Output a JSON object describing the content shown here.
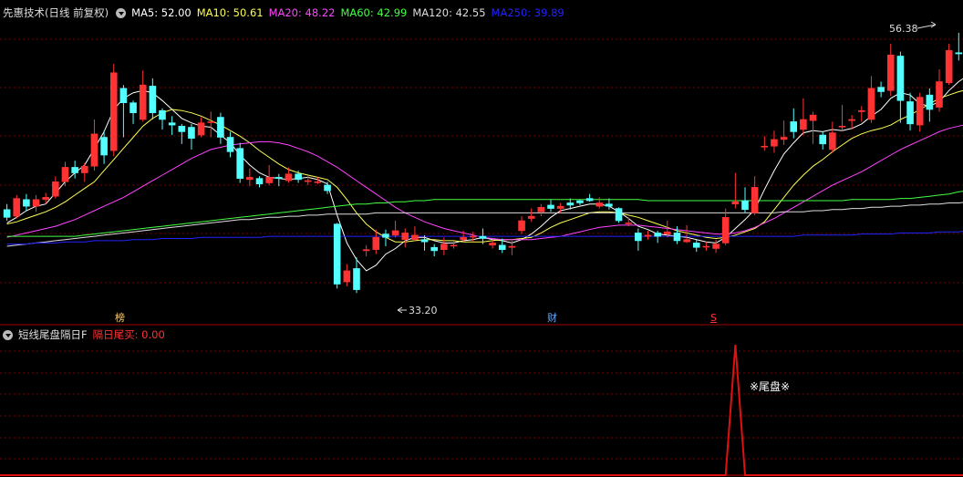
{
  "main_panel": {
    "title": "先惠技术(日线 前复权)",
    "ma_labels": [
      {
        "text": "MA5: 52.00",
        "color": "#ffffff"
      },
      {
        "text": "MA10: 50.61",
        "color": "#ffff55"
      },
      {
        "text": "MA20: 48.22",
        "color": "#ff44ff"
      },
      {
        "text": "MA60: 42.99",
        "color": "#44ff44"
      },
      {
        "text": "MA120: 42.55",
        "color": "#dddddd"
      },
      {
        "text": "MA250: 39.89",
        "color": "#2222ff"
      }
    ],
    "high_label": "56.38",
    "low_label": "33.20",
    "markers": [
      {
        "text": "榜",
        "color": "#ffcc66"
      },
      {
        "text": "财",
        "color": "#66aaff"
      },
      {
        "text": "S",
        "color": "#ff3333"
      }
    ]
  },
  "sub_panel": {
    "title": "短线尾盘隔日F",
    "indicator_label": "隔日尾买: 0.00",
    "signal_text": "※尾盘※"
  },
  "chart_data": {
    "type": "candlestick",
    "price_range": [
      31.3,
      57.7
    ],
    "up_color": "#ff3333",
    "down_color": "#54ffff",
    "candles": [
      [
        40.5,
        39.8,
        41.0,
        39.5
      ],
      [
        39.9,
        41.5,
        41.8,
        39.7
      ],
      [
        41.4,
        40.8,
        41.9,
        40.4
      ],
      [
        40.8,
        41.4,
        41.8,
        40.3
      ],
      [
        41.4,
        41.6,
        42.0,
        41.0
      ],
      [
        41.7,
        43.0,
        43.5,
        41.5
      ],
      [
        43.0,
        44.3,
        44.8,
        42.6
      ],
      [
        44.3,
        43.8,
        44.9,
        43.3
      ],
      [
        43.8,
        44.4,
        44.7,
        43.0
      ],
      [
        44.4,
        47.3,
        48.6,
        44.0
      ],
      [
        47.0,
        45.4,
        47.6,
        44.6
      ],
      [
        45.8,
        52.8,
        53.6,
        45.3
      ],
      [
        51.4,
        50.1,
        51.7,
        47.0
      ],
      [
        50.1,
        49.2,
        50.3,
        48.2
      ],
      [
        48.6,
        51.7,
        53.0,
        48.4
      ],
      [
        51.6,
        49.2,
        52.3,
        48.6
      ],
      [
        49.4,
        48.6,
        49.6,
        47.7
      ],
      [
        48.3,
        48.1,
        48.9,
        47.2
      ],
      [
        48.0,
        47.5,
        48.2,
        46.4
      ],
      [
        47.9,
        46.9,
        48.2,
        45.9
      ],
      [
        47.2,
        48.3,
        48.8,
        47.0
      ],
      [
        48.4,
        48.4,
        49.3,
        47.0
      ],
      [
        48.8,
        47.0,
        49.2,
        46.4
      ],
      [
        47.0,
        45.7,
        47.5,
        45.2
      ],
      [
        46.0,
        43.3,
        46.5,
        42.9
      ],
      [
        43.2,
        43.4,
        44.2,
        42.6
      ],
      [
        43.3,
        42.8,
        43.5,
        42.5
      ],
      [
        42.9,
        43.4,
        44.5,
        42.7
      ],
      [
        43.4,
        43.3,
        43.7,
        42.6
      ],
      [
        43.1,
        43.7,
        44.3,
        42.9
      ],
      [
        43.7,
        43.2,
        44.0,
        42.9
      ],
      [
        43.1,
        43.1,
        43.5,
        42.7
      ],
      [
        43.0,
        43.0,
        43.4,
        42.8
      ],
      [
        42.7,
        42.2,
        43.0,
        41.9
      ],
      [
        39.2,
        33.8,
        39.3,
        33.4
      ],
      [
        34.0,
        35.0,
        35.6,
        33.6
      ],
      [
        35.2,
        33.3,
        36.2,
        33.0
      ],
      [
        36.8,
        36.9,
        37.3,
        36.3
      ],
      [
        36.9,
        38.0,
        38.7,
        36.5
      ],
      [
        38.3,
        38.0,
        38.7,
        37.2
      ],
      [
        38.2,
        38.6,
        39.5,
        38.0
      ],
      [
        37.8,
        38.4,
        38.8,
        37.1
      ],
      [
        37.8,
        38.2,
        39.0,
        37.7
      ],
      [
        37.8,
        37.6,
        38.2,
        36.8
      ],
      [
        37.1,
        36.8,
        37.4,
        36.3
      ],
      [
        36.9,
        37.4,
        38.0,
        36.4
      ],
      [
        37.3,
        37.3,
        37.7,
        37.0
      ],
      [
        37.8,
        38.0,
        38.6,
        37.6
      ],
      [
        38.1,
        38.1,
        38.5,
        37.6
      ],
      [
        38.1,
        37.9,
        38.8,
        37.4
      ],
      [
        37.3,
        37.5,
        37.8,
        37.0
      ],
      [
        37.3,
        36.9,
        37.9,
        36.6
      ],
      [
        37.1,
        37.2,
        37.7,
        36.4
      ],
      [
        38.6,
        39.5,
        39.9,
        38.3
      ],
      [
        39.7,
        39.9,
        40.6,
        39.4
      ],
      [
        40.3,
        40.7,
        41.0,
        39.9
      ],
      [
        40.9,
        40.6,
        41.4,
        40.3
      ],
      [
        40.6,
        40.8,
        41.1,
        40.2
      ],
      [
        41.1,
        40.9,
        41.5,
        40.5
      ],
      [
        41.3,
        41.1,
        41.4,
        40.9
      ],
      [
        41.5,
        41.3,
        41.9,
        41.2
      ],
      [
        40.8,
        41.1,
        41.6,
        40.6
      ],
      [
        41.0,
        40.8,
        41.5,
        40.5
      ],
      [
        40.6,
        39.5,
        40.7,
        39.3
      ],
      [
        39.3,
        39.3,
        39.8,
        39.0
      ],
      [
        38.4,
        37.7,
        38.8,
        36.8
      ],
      [
        38.1,
        38.2,
        38.6,
        37.8
      ],
      [
        38.4,
        38.1,
        38.6,
        37.5
      ],
      [
        38.3,
        38.5,
        39.5,
        38.0
      ],
      [
        38.4,
        37.7,
        39.0,
        37.4
      ],
      [
        37.6,
        37.8,
        39.1,
        37.5
      ],
      [
        37.5,
        37.1,
        37.8,
        36.7
      ],
      [
        37.2,
        37.2,
        37.6,
        36.8
      ],
      [
        37.0,
        37.4,
        37.8,
        36.6
      ],
      [
        37.5,
        39.8,
        40.6,
        37.3
      ],
      [
        41.0,
        41.2,
        43.8,
        40.6
      ],
      [
        41.3,
        40.5,
        42.5,
        40.2
      ],
      [
        40.2,
        42.5,
        43.5,
        40.0
      ],
      [
        46.2,
        46.2,
        47.1,
        45.8
      ],
      [
        46.2,
        46.8,
        47.6,
        45.6
      ],
      [
        46.8,
        47.0,
        48.5,
        46.3
      ],
      [
        48.4,
        47.5,
        49.6,
        46.9
      ],
      [
        47.7,
        48.6,
        50.5,
        47.2
      ],
      [
        48.5,
        49.0,
        49.3,
        46.4
      ],
      [
        47.2,
        46.4,
        47.5,
        45.9
      ],
      [
        45.9,
        47.4,
        48.4,
        45.6
      ],
      [
        48.0,
        48.0,
        49.9,
        47.6
      ],
      [
        48.5,
        48.6,
        49.0,
        47.7
      ],
      [
        49.3,
        49.4,
        49.8,
        48.4
      ],
      [
        48.6,
        51.4,
        52.5,
        48.3
      ],
      [
        51.5,
        51.1,
        52.0,
        50.6
      ],
      [
        51.2,
        54.4,
        55.4,
        50.7
      ],
      [
        54.3,
        50.3,
        54.7,
        48.3
      ],
      [
        50.2,
        48.2,
        51.0,
        47.6
      ],
      [
        48.1,
        50.6,
        51.0,
        47.5
      ],
      [
        50.8,
        49.5,
        51.4,
        48.4
      ],
      [
        49.7,
        52.0,
        53.1,
        49.3
      ],
      [
        51.9,
        54.8,
        55.4,
        51.7
      ],
      [
        54.6,
        54.5,
        56.4,
        53.9
      ],
      [
        54.8,
        55.4,
        56.7,
        54.3
      ]
    ],
    "ma_lines": [
      {
        "name": "MA5",
        "color": "#ffffff",
        "values": [
          39.3,
          39.8,
          40.4,
          40.8,
          41.0,
          42.0,
          43.0,
          43.8,
          44.5,
          46.0,
          47.5,
          49.5,
          50.5,
          51.0,
          51.2,
          51.0,
          50.3,
          49.5,
          48.7,
          48.3,
          48.0,
          47.9,
          47.2,
          46.5,
          45.4,
          44.5,
          43.8,
          43.4,
          43.3,
          43.2,
          43.3,
          43.4,
          43.2,
          42.8,
          40.0,
          37.5,
          36.0,
          35.0,
          35.5,
          36.5,
          37.0,
          37.7,
          38.0,
          38.0,
          37.7,
          37.5,
          37.5,
          37.7,
          37.8,
          38.0,
          37.8,
          37.7,
          37.5,
          37.8,
          38.3,
          39.0,
          39.8,
          40.4,
          40.6,
          40.8,
          41.0,
          41.0,
          40.8,
          40.3,
          39.7,
          39.0,
          38.7,
          38.3,
          38.2,
          38.1,
          38.0,
          37.8,
          37.6,
          37.5,
          38.0,
          38.8,
          39.6,
          40.5,
          42.3,
          44.0,
          45.5,
          46.5,
          47.4,
          47.6,
          47.5,
          47.7,
          47.6,
          47.8,
          48.2,
          48.9,
          49.5,
          50.5,
          51.0,
          50.8,
          50.0,
          49.8,
          50.2,
          51.2,
          52.0,
          52.6
        ]
      },
      {
        "name": "MA10",
        "color": "#ffff55",
        "values": [
          39.2,
          39.4,
          39.7,
          40.0,
          40.3,
          40.7,
          41.2,
          41.8,
          42.4,
          43.0,
          44.0,
          45.0,
          46.0,
          47.0,
          48.0,
          48.7,
          49.2,
          49.5,
          49.4,
          49.2,
          48.9,
          48.5,
          48.1,
          47.6,
          47.1,
          46.5,
          45.8,
          45.2,
          44.6,
          44.1,
          43.8,
          43.6,
          43.4,
          43.2,
          42.5,
          41.4,
          40.2,
          39.2,
          38.5,
          38.0,
          37.6,
          37.6,
          37.7,
          37.8,
          37.8,
          37.7,
          37.7,
          37.6,
          37.6,
          37.6,
          37.7,
          37.8,
          37.8,
          37.9,
          38.0,
          38.4,
          38.9,
          39.3,
          39.6,
          39.9,
          40.2,
          40.3,
          40.3,
          40.2,
          40.0,
          39.8,
          39.5,
          39.2,
          38.9,
          38.6,
          38.4,
          38.2,
          38.0,
          37.9,
          38.0,
          38.2,
          38.5,
          38.8,
          39.4,
          40.5,
          41.6,
          42.7,
          43.6,
          44.4,
          45.0,
          45.7,
          46.3,
          46.9,
          47.3,
          47.6,
          47.8,
          48.1,
          48.6,
          49.0,
          49.5,
          50.0,
          50.5,
          50.8,
          51.1,
          51.3
        ]
      },
      {
        "name": "MA20",
        "color": "#ff44ff",
        "values": [
          38.0,
          38.2,
          38.4,
          38.6,
          38.8,
          39.0,
          39.3,
          39.6,
          40.0,
          40.4,
          40.8,
          41.2,
          41.6,
          42.1,
          42.6,
          43.1,
          43.6,
          44.1,
          44.6,
          45.1,
          45.5,
          45.9,
          46.1,
          46.3,
          46.4,
          46.5,
          46.6,
          46.6,
          46.5,
          46.3,
          46.0,
          45.7,
          45.3,
          44.8,
          44.3,
          43.7,
          43.1,
          42.5,
          41.9,
          41.3,
          40.7,
          40.2,
          39.8,
          39.4,
          39.1,
          38.8,
          38.6,
          38.4,
          38.2,
          38.0,
          37.9,
          37.8,
          37.8,
          37.8,
          37.8,
          37.9,
          38.0,
          38.1,
          38.3,
          38.5,
          38.7,
          38.9,
          39.0,
          39.1,
          39.1,
          39.1,
          39.0,
          38.9,
          38.8,
          38.7,
          38.6,
          38.5,
          38.4,
          38.3,
          38.3,
          38.4,
          38.6,
          38.9,
          39.3,
          39.7,
          40.2,
          40.7,
          41.2,
          41.7,
          42.2,
          42.7,
          43.1,
          43.5,
          43.9,
          44.4,
          44.9,
          45.4,
          45.9,
          46.3,
          46.7,
          47.1,
          47.5,
          47.8,
          48.0,
          48.2
        ]
      },
      {
        "name": "MA60",
        "color": "#44ff44",
        "values": [
          38.1,
          38.1,
          38.1,
          38.1,
          38.1,
          38.1,
          38.1,
          38.1,
          38.2,
          38.3,
          38.4,
          38.5,
          38.6,
          38.7,
          38.8,
          38.9,
          39.0,
          39.1,
          39.2,
          39.3,
          39.4,
          39.5,
          39.6,
          39.7,
          39.8,
          39.9,
          40.0,
          40.1,
          40.2,
          40.3,
          40.4,
          40.5,
          40.6,
          40.7,
          40.8,
          40.9,
          41.0,
          41.0,
          41.1,
          41.1,
          41.2,
          41.2,
          41.3,
          41.3,
          41.4,
          41.4,
          41.4,
          41.4,
          41.4,
          41.4,
          41.4,
          41.4,
          41.4,
          41.4,
          41.4,
          41.4,
          41.4,
          41.4,
          41.4,
          41.4,
          41.4,
          41.4,
          41.4,
          41.4,
          41.4,
          41.4,
          41.3,
          41.3,
          41.3,
          41.3,
          41.3,
          41.3,
          41.3,
          41.3,
          41.3,
          41.3,
          41.3,
          41.3,
          41.3,
          41.3,
          41.3,
          41.3,
          41.3,
          41.3,
          41.3,
          41.3,
          41.3,
          41.4,
          41.4,
          41.4,
          41.4,
          41.4,
          41.5,
          41.5,
          41.6,
          41.7,
          41.8,
          41.9,
          42.1,
          42.2
        ]
      },
      {
        "name": "MA120",
        "color": "#dddddd",
        "values": [
          37.2,
          37.3,
          37.4,
          37.5,
          37.6,
          37.7,
          37.8,
          37.9,
          38.0,
          38.1,
          38.2,
          38.3,
          38.4,
          38.5,
          38.6,
          38.7,
          38.8,
          38.9,
          39.0,
          39.1,
          39.2,
          39.3,
          39.4,
          39.5,
          39.6,
          39.6,
          39.7,
          39.8,
          39.8,
          39.9,
          39.9,
          40.0,
          40.0,
          40.1,
          40.1,
          40.1,
          40.1,
          40.1,
          40.2,
          40.2,
          40.2,
          40.2,
          40.2,
          40.2,
          40.2,
          40.2,
          40.2,
          40.2,
          40.2,
          40.2,
          40.2,
          40.2,
          40.2,
          40.2,
          40.2,
          40.2,
          40.2,
          40.2,
          40.2,
          40.2,
          40.2,
          40.2,
          40.2,
          40.2,
          40.2,
          40.2,
          40.2,
          40.2,
          40.2,
          40.2,
          40.2,
          40.2,
          40.2,
          40.2,
          40.2,
          40.2,
          40.2,
          40.2,
          40.2,
          40.2,
          40.3,
          40.3,
          40.3,
          40.4,
          40.4,
          40.5,
          40.5,
          40.6,
          40.6,
          40.7,
          40.7,
          40.8,
          40.8,
          40.9,
          40.9,
          41.0,
          41.0,
          41.1,
          41.1,
          41.2
        ]
      },
      {
        "name": "MA250",
        "color": "#2222ff",
        "values": [
          37.4,
          37.4,
          37.4,
          37.5,
          37.5,
          37.5,
          37.6,
          37.6,
          37.6,
          37.7,
          37.7,
          37.7,
          37.7,
          37.8,
          37.8,
          37.8,
          37.9,
          37.9,
          37.9,
          37.9,
          38.0,
          38.0,
          38.0,
          38.0,
          38.0,
          38.0,
          38.0,
          38.1,
          38.1,
          38.1,
          38.1,
          38.1,
          38.1,
          38.1,
          38.1,
          38.1,
          38.1,
          38.1,
          38.1,
          38.1,
          38.1,
          38.1,
          38.1,
          38.1,
          38.1,
          38.1,
          38.1,
          38.1,
          38.1,
          38.1,
          38.1,
          38.1,
          38.1,
          38.1,
          38.1,
          38.1,
          38.1,
          38.1,
          38.1,
          38.1,
          38.1,
          38.1,
          38.1,
          38.1,
          38.1,
          38.1,
          38.1,
          38.1,
          38.1,
          38.1,
          38.1,
          38.1,
          38.1,
          38.1,
          38.1,
          38.1,
          38.1,
          38.1,
          38.1,
          38.1,
          38.1,
          38.1,
          38.2,
          38.2,
          38.2,
          38.2,
          38.2,
          38.2,
          38.3,
          38.3,
          38.3,
          38.3,
          38.4,
          38.4,
          38.4,
          38.4,
          38.5,
          38.5,
          38.5,
          38.6
        ]
      }
    ],
    "sub_indicator": {
      "name": "隔日尾买",
      "signal_bar": 75,
      "range": [
        0,
        1
      ]
    }
  }
}
